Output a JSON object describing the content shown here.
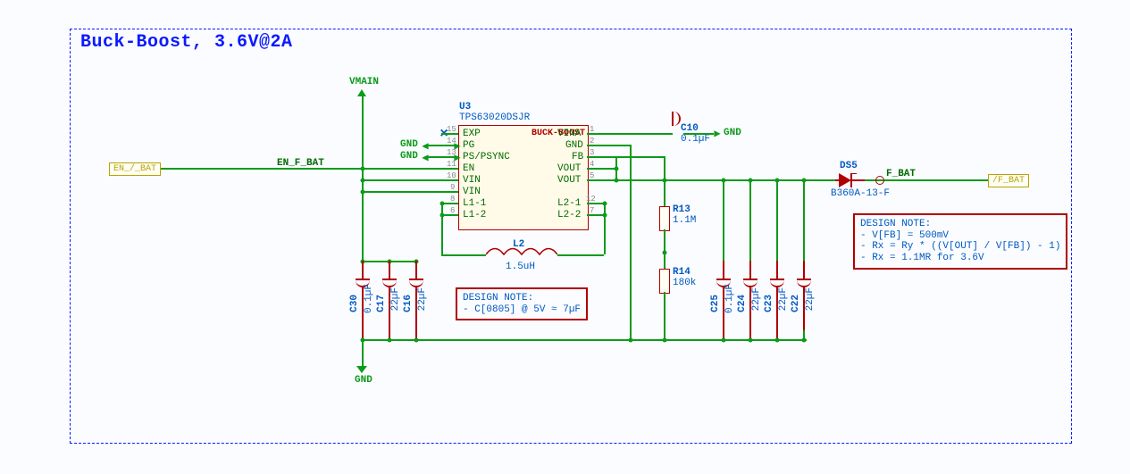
{
  "block": {
    "title": "Buck-Boost, 3.6V@2A"
  },
  "power": {
    "vmain": "VMAIN",
    "gnd": "GND"
  },
  "net_left": {
    "name": "EN_/_BAT",
    "signal": "EN_F_BAT"
  },
  "net_right": {
    "name": "/F_BAT",
    "signal": "F_BAT"
  },
  "ic": {
    "ref": "U3",
    "part": "TPS63020DSJR",
    "title": "BUCK-BOOST",
    "pins_left": [
      {
        "num": "15",
        "name": "EXP"
      },
      {
        "num": "14",
        "name": "PG"
      },
      {
        "num": "13",
        "name": "PS/PSYNC"
      },
      {
        "num": "11",
        "name": "EN"
      },
      {
        "num": "10",
        "name": "VIN"
      },
      {
        "num": "9",
        "name": "VIN"
      },
      {
        "num": "8",
        "name": "L1-1"
      },
      {
        "num": "6",
        "name": "L1-2"
      }
    ],
    "pins_right": [
      {
        "num": "1",
        "name": "VINA"
      },
      {
        "num": "2",
        "name": "GND"
      },
      {
        "num": "3",
        "name": "FB"
      },
      {
        "num": "4",
        "name": "VOUT"
      },
      {
        "num": "5",
        "name": "VOUT"
      },
      {
        "num": "12",
        "name": "L2-1"
      },
      {
        "num": "7",
        "name": "L2-2"
      }
    ]
  },
  "L2": {
    "ref": "L2",
    "value": "1.5uH"
  },
  "C10": {
    "ref": "C10",
    "value": "0.1µF"
  },
  "R13": {
    "ref": "R13",
    "value": "1.1M"
  },
  "R14": {
    "ref": "R14",
    "value": "180k"
  },
  "C30": {
    "ref": "C30",
    "value": "0.1µF"
  },
  "C17": {
    "ref": "C17",
    "value": "22µF"
  },
  "C16": {
    "ref": "C16",
    "value": "22µF"
  },
  "C25": {
    "ref": "C25",
    "value": "0.1µF"
  },
  "C24": {
    "ref": "C24",
    "value": "22µF"
  },
  "C23": {
    "ref": "C23",
    "value": "22µF"
  },
  "C22": {
    "ref": "C22",
    "value": "22µF"
  },
  "DS5": {
    "ref": "DS5",
    "value": "B360A-13-F"
  },
  "note1": {
    "title": "DESIGN NOTE:",
    "line1": "- C[0805] @ 5V ≈ 7µF"
  },
  "note2": {
    "title": "DESIGN NOTE:",
    "line1": "- V[FB] = 500mV",
    "line2": "- Rx = Ry * ((V[OUT] / V[FB]) - 1)",
    "line3": "- Rx = 1.1MR for 3.6V"
  }
}
